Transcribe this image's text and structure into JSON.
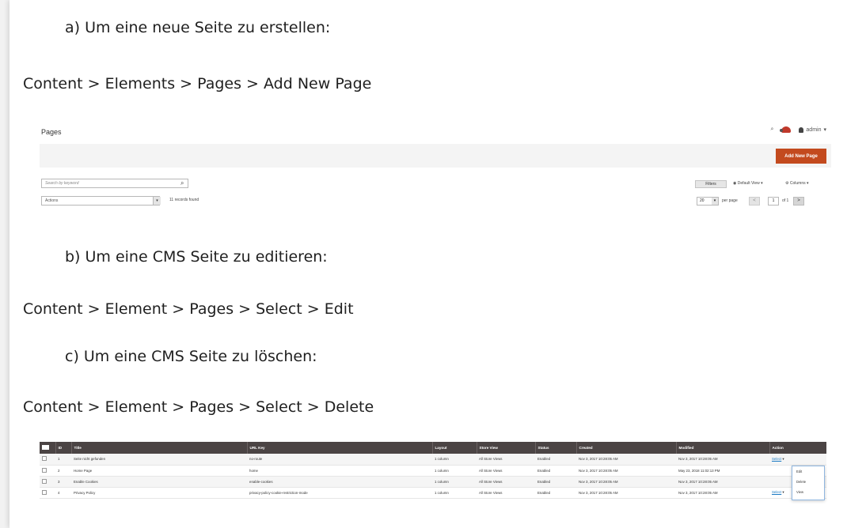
{
  "steps": {
    "a_label": "a)  Um eine neue Seite zu erstellen:",
    "a_path": "Content > Elements > Pages > Add New Page",
    "b_label": "b)  Um eine CMS Seite zu editieren:",
    "b_path": "Content > Element > Pages > Select > Edit",
    "c_label": "c)  Um eine CMS Seite zu löschen:",
    "c_path": "Content > Element > Pages > Select > Delete"
  },
  "pages_header": {
    "title": "Pages",
    "user_label": "admin",
    "add_button": "Add New Page",
    "search_placeholder": "Search by keyword",
    "actions_label": "Actions",
    "records_found": "11 records found",
    "filters_label": "Filters",
    "default_view": "Default View",
    "columns": "Columns",
    "per_page_value": "20",
    "per_page_label": "per page",
    "page_number": "1",
    "page_of": "of 1",
    "prev_glyph": "<",
    "next_glyph": ">",
    "actions_arrow": "▾"
  },
  "grid": {
    "columns": [
      "",
      "ID",
      "Title",
      "URL Key",
      "Layout",
      "Store View",
      "Status",
      "Created",
      "Modified",
      "Action"
    ],
    "rows": [
      [
        "1",
        "Seite nicht gefunden",
        "no-route",
        "1 column",
        "All Store Views",
        "Enabled",
        "Nov 3, 2017 10:28:05 AM",
        "Nov 3, 2017 10:28:05 AM",
        "Select"
      ],
      [
        "2",
        "Home Page",
        "home",
        "1 column",
        "All Store Views",
        "Enabled",
        "Nov 3, 2017 10:28:05 AM",
        "May 23, 2018 11:02:13 PM",
        "Select"
      ],
      [
        "3",
        "Enable Cookies",
        "enable-cookies",
        "1 column",
        "All Store Views",
        "Enabled",
        "Nov 3, 2017 10:28:05 AM",
        "Nov 3, 2017 10:28:05 AM",
        "Select"
      ],
      [
        "4",
        "Privacy Policy",
        "privacy-policy-cookie-restriction-mode",
        "1 column",
        "All Store Views",
        "Enabled",
        "Nov 3, 2017 10:28:05 AM",
        "Nov 3, 2017 10:28:05 AM",
        "Select"
      ]
    ],
    "dropdown": [
      "Edit",
      "Delete",
      "View"
    ]
  }
}
